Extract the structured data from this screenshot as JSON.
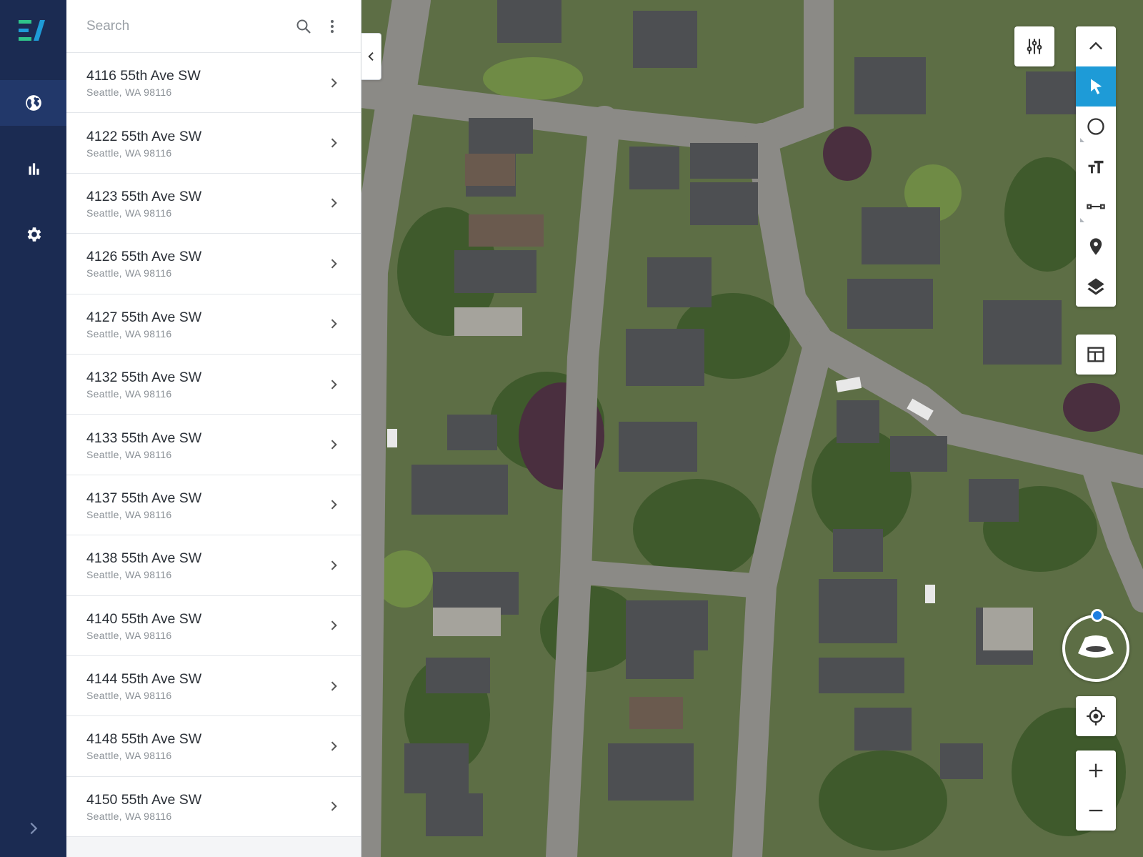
{
  "app": {
    "logo": "EV"
  },
  "rail": {
    "items": [
      {
        "name": "globe-icon",
        "active": true
      },
      {
        "name": "bar-chart-icon",
        "active": false
      },
      {
        "name": "gear-icon",
        "active": false
      }
    ]
  },
  "search": {
    "placeholder": "Search"
  },
  "addresses": [
    {
      "line1": "4116 55th Ave SW",
      "line2": "Seattle, WA 98116"
    },
    {
      "line1": "4122 55th Ave SW",
      "line2": "Seattle, WA 98116"
    },
    {
      "line1": "4123 55th Ave SW",
      "line2": "Seattle, WA 98116"
    },
    {
      "line1": "4126 55th Ave SW",
      "line2": "Seattle, WA 98116"
    },
    {
      "line1": "4127 55th Ave SW",
      "line2": "Seattle, WA 98116"
    },
    {
      "line1": "4132 55th Ave SW",
      "line2": "Seattle, WA 98116"
    },
    {
      "line1": "4133 55th Ave SW",
      "line2": "Seattle, WA 98116"
    },
    {
      "line1": "4137 55th Ave SW",
      "line2": "Seattle, WA 98116"
    },
    {
      "line1": "4138 55th Ave SW",
      "line2": "Seattle, WA 98116"
    },
    {
      "line1": "4140 55th Ave SW",
      "line2": "Seattle, WA 98116"
    },
    {
      "line1": "4144 55th Ave SW",
      "line2": "Seattle, WA 98116"
    },
    {
      "line1": "4148 55th Ave SW",
      "line2": "Seattle, WA 98116"
    },
    {
      "line1": "4150 55th Ave SW",
      "line2": "Seattle, WA 98116"
    }
  ],
  "toolbar": {
    "tools": [
      "chevron-up-icon",
      "pointer-icon",
      "circle-icon",
      "text-size-icon",
      "measure-line-icon",
      "map-pin-icon",
      "layers-icon"
    ],
    "selected_tool": "pointer-icon"
  },
  "colors": {
    "rail_bg": "#1b2b52",
    "rail_active": "#22386a",
    "accent": "#1e9bd7",
    "logo_green": "#2fc48a",
    "logo_blue": "#1e9bd7"
  }
}
